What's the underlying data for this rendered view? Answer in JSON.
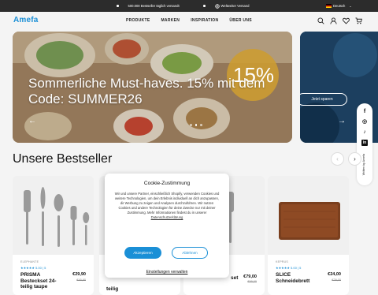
{
  "topbar": {
    "item1": "500.000 Bestseller täglich versandt",
    "item2": "Weltweiter Versand",
    "lang": "Deutsch"
  },
  "nav": {
    "logo": "Amefa",
    "menu": [
      "PRODUKTE",
      "MARKEN",
      "INSPIRATION",
      "ÜBER UNS"
    ]
  },
  "hero": {
    "headline": "Sommerliche Must-haves. 15% mit dem Code: SUMMER26",
    "badge": "15%",
    "cta": "Jetzt sparen"
  },
  "social": {
    "icons": [
      "f",
      "◎",
      "♪",
      "in"
    ],
    "vertical": "Written by Amefa"
  },
  "bestsellers": {
    "heading": "Unsere Bestseller",
    "products": [
      {
        "brand": "ELEPHANTE",
        "rating": "★★★★★ 5.00 | 5",
        "title": "PRISMA Besteckset 24-teilig taupe",
        "price": "€29,90",
        "old": "€45,90"
      },
      {
        "title2": "teilig"
      },
      {
        "title2": "set",
        "price": "€79,00",
        "old": "€99,00"
      },
      {
        "brand": "KEPRUS",
        "rating": "★★★★★ 5.00 | 5",
        "title": "SLICE Schneidebrett",
        "price": "€24,00",
        "old": "€29,00"
      }
    ]
  },
  "cookie": {
    "title": "Cookie-Zustimmung",
    "text": "Wir und unsere Partner, einschließlich Shopify, verwenden Cookies und weitere Technologien, um dein Erlebnis individuell an dich anzupassen, dir Werbung zu zeigen und Analysen durchzuführen. Wir nutzen Cookies und andere Technologien für deine Zwecke nur mit deiner Zustimmung. Mehr Informationen findest du in unserer ",
    "link": "Datenschutzerklärung",
    "accept": "Akzeptieren",
    "decline": "Ablehnen",
    "settings": "Einstellungen verwalten"
  },
  "colors": {
    "accent": "#1a8fd6",
    "topbar": "#2c2c2c"
  }
}
